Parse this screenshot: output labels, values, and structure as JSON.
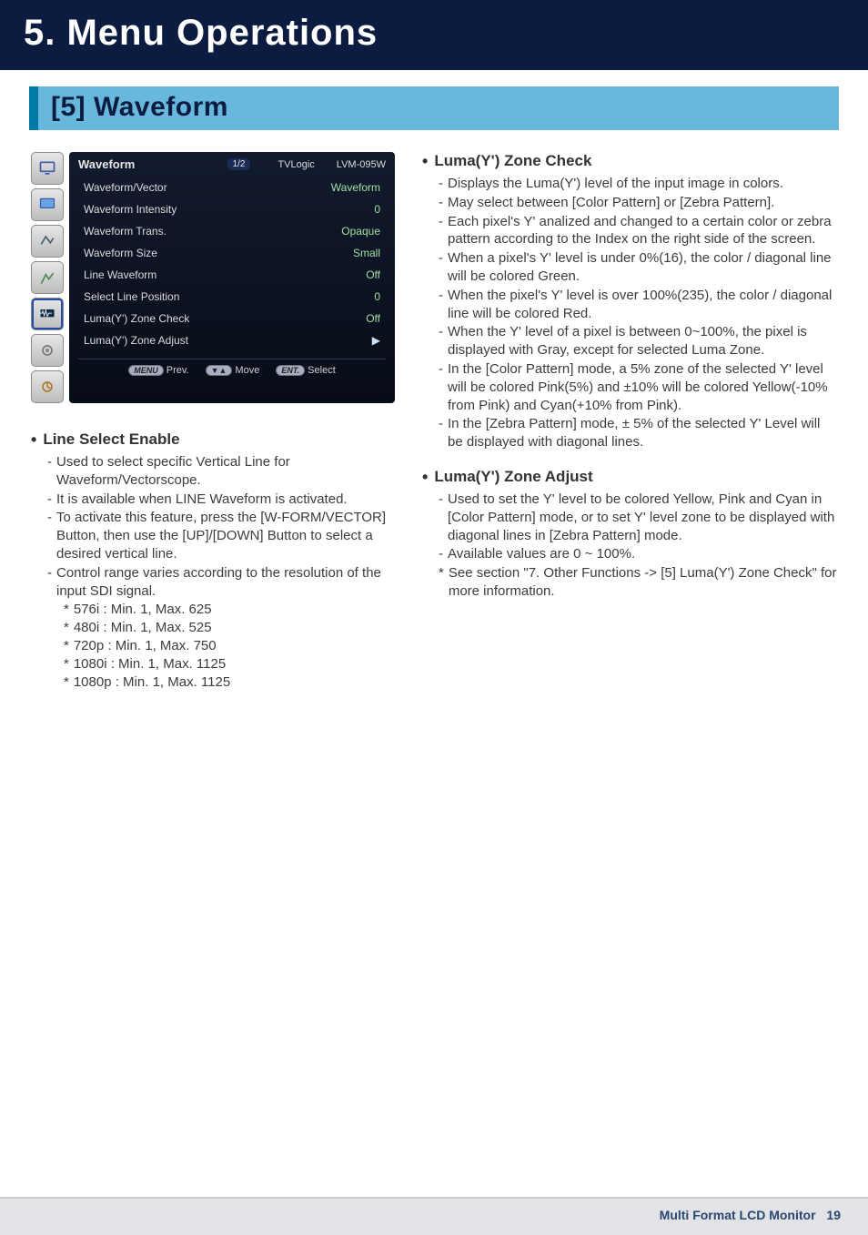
{
  "page": {
    "chapter_title": "5. Menu Operations",
    "section_title": "[5] Waveform",
    "footer_label": "Multi Format LCD Monitor",
    "page_number": "19"
  },
  "osd": {
    "title": "Waveform",
    "page_indicator": "1/2",
    "brand": "TVLogic",
    "model": "LVM-095W",
    "rows": [
      {
        "label": "Waveform/Vector",
        "value": "Waveform"
      },
      {
        "label": "Waveform Intensity",
        "value": "0"
      },
      {
        "label": "Waveform Trans.",
        "value": "Opaque"
      },
      {
        "label": "Waveform Size",
        "value": "Small"
      },
      {
        "label": "Line Waveform",
        "value": "Off"
      },
      {
        "label": "Select Line Position",
        "value": "0"
      },
      {
        "label": "Luma(Y') Zone Check",
        "value": "Off"
      },
      {
        "label": "Luma(Y') Zone Adjust",
        "value": "▶"
      }
    ],
    "footer": {
      "prev_key": "MENU",
      "prev_label": "Prev.",
      "move_key": "▼▲",
      "move_label": "Move",
      "select_key": "ENT.",
      "select_label": "Select"
    }
  },
  "left": {
    "t1_title": "Line Select Enable",
    "t1_d1": "Used to select specific Vertical Line for Waveform/Vectorscope.",
    "t1_d2": "It is available when LINE Waveform is activated.",
    "t1_d3": "To activate this feature, press the [W-FORM/VECTOR] Button, then use the [UP]/[DOWN] Button to select a desired vertical line.",
    "t1_d4": "Control range varies according to the resolution of the input SDI signal.",
    "t1_s1": "576i : Min. 1, Max. 625",
    "t1_s2": "480i : Min. 1, Max. 525",
    "t1_s3": "720p : Min. 1, Max. 750",
    "t1_s4": "1080i : Min. 1, Max. 1125",
    "t1_s5": "1080p : Min. 1, Max. 1125"
  },
  "right": {
    "t2_title": "Luma(Y') Zone Check",
    "t2_d1": "Displays the Luma(Y') level of the input image in colors.",
    "t2_d2": "May select between [Color Pattern] or [Zebra Pattern].",
    "t2_d3": "Each pixel's Y' analized and changed to a certain color or zebra pattern according to the Index on the right side of the screen.",
    "t2_d4": "When a pixel's Y' level is under 0%(16), the color / diagonal line will be colored Green.",
    "t2_d5": "When the pixel's Y' level is over 100%(235), the color / diagonal line will be colored Red.",
    "t2_d6": "When the Y' level of a pixel is between 0~100%, the pixel is displayed with Gray, except for selected Luma Zone.",
    "t2_d7": "In the [Color Pattern] mode, a 5% zone of the selected Y' level will be colored Pink(5%) and ±10% will be colored Yellow(-10% from Pink) and Cyan(+10% from Pink).",
    "t2_d8": "In the [Zebra Pattern] mode, ± 5% of the selected Y' Level will be displayed with diagonal lines.",
    "t3_title": "Luma(Y') Zone Adjust",
    "t3_d1": "Used to set the Y' level to be colored Yellow, Pink and Cyan in [Color Pattern] mode, or to set Y' level zone to be displayed with diagonal lines in [Zebra Pattern] mode.",
    "t3_d2": "Available values are 0 ~ 100%.",
    "t3_s1": "See section \"7. Other Functions -> [5] Luma(Y') Zone Check\" for more information."
  }
}
